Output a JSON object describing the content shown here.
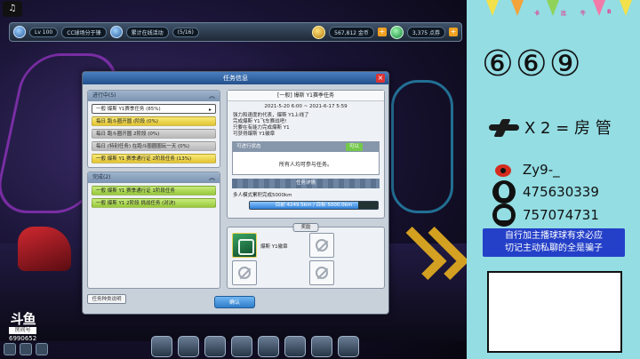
{
  "game": {
    "topbar": {
      "level_text": "Lv 100",
      "account_text": "CC球场分于锋",
      "event_text": "累计在线活动",
      "event_count": "(5/16)",
      "gold_text": "567,812 金币",
      "points_text": "3,375 点券"
    },
    "watermark": {
      "logo": "斗鱼",
      "sub": "房间号",
      "room": "6990652"
    }
  },
  "dialog": {
    "title": "任务信息",
    "close": "×",
    "left": {
      "in_progress_header": "进行中(5)",
      "in_progress_tasks": [
        {
          "label": "一般 爆斯 Y1赛季任务 (85%)",
          "style": "white",
          "selected": true
        },
        {
          "label": "每日 跑斗圈开圆 (阶段 (0%)",
          "style": "yellow"
        },
        {
          "label": "每日 跑斗圈开圆 2阶段 (0%)",
          "style": "grey"
        },
        {
          "label": "每日 (特别任务) 在跑斗圈圈圈玩一天 (0%)",
          "style": "grey"
        },
        {
          "label": "一般 爆斯 Y1 赛季通行证 2阶段任务 (13%)",
          "style": "yellow"
        }
      ],
      "completed_header": "完成(2)",
      "completed_tasks": [
        {
          "label": "一般 爆斯 Y1 赛季通行证 1阶段任务",
          "style": "green"
        },
        {
          "label": "一般 爆斯 Y1 2阶段 挑战任务 (对决)",
          "style": "green"
        }
      ],
      "help_button": "任务种类说明"
    },
    "right": {
      "task_title": "[一般] 爆斯 Y1赛季任务",
      "date_start": "2021-5-20 6:00",
      "date_sep": "~",
      "date_end": "2021-6-17 5:59",
      "desc_lines": [
        "强力和速度的代表，爆斯 Y1上线了",
        "完成爆斯 Y1飞车赛战吧!",
        "只要在有能力完成爆斯 Y1",
        "可获得爆斯 Y1徽章"
      ],
      "status_header": "可进行状态",
      "status_badge": "可以",
      "status_text": "所有人均可参与任务。",
      "requirement_header": "任务详情",
      "requirement_text": "多人模式累积完成5000km",
      "progress_label": "目前 4249.5km / 目标 5000.0km",
      "progress_value": 0.85,
      "reward_header": "奖励",
      "reward_item": "爆斯 Y1徽章"
    },
    "confirm_button": "确认"
  },
  "overlay": {
    "room_digits": "⑥⑥⑨",
    "plane_text": "X 2 = 房 管",
    "weibo": "Zy9-_",
    "qq": "475630339",
    "qq_group": "757074731",
    "notice_line1": "自行加主播球球有求必应",
    "notice_line2": "切记主动私聊的全是骗子",
    "bunting_letters": [
      "卡",
      "比",
      "牛",
      "B"
    ],
    "music_icon": "♫"
  },
  "colors": {
    "overlay_bg": "#93dde3",
    "notice_bg": "#2440c8",
    "dialog_title": "#234f8c",
    "weibo_red": "#d52b1e"
  }
}
